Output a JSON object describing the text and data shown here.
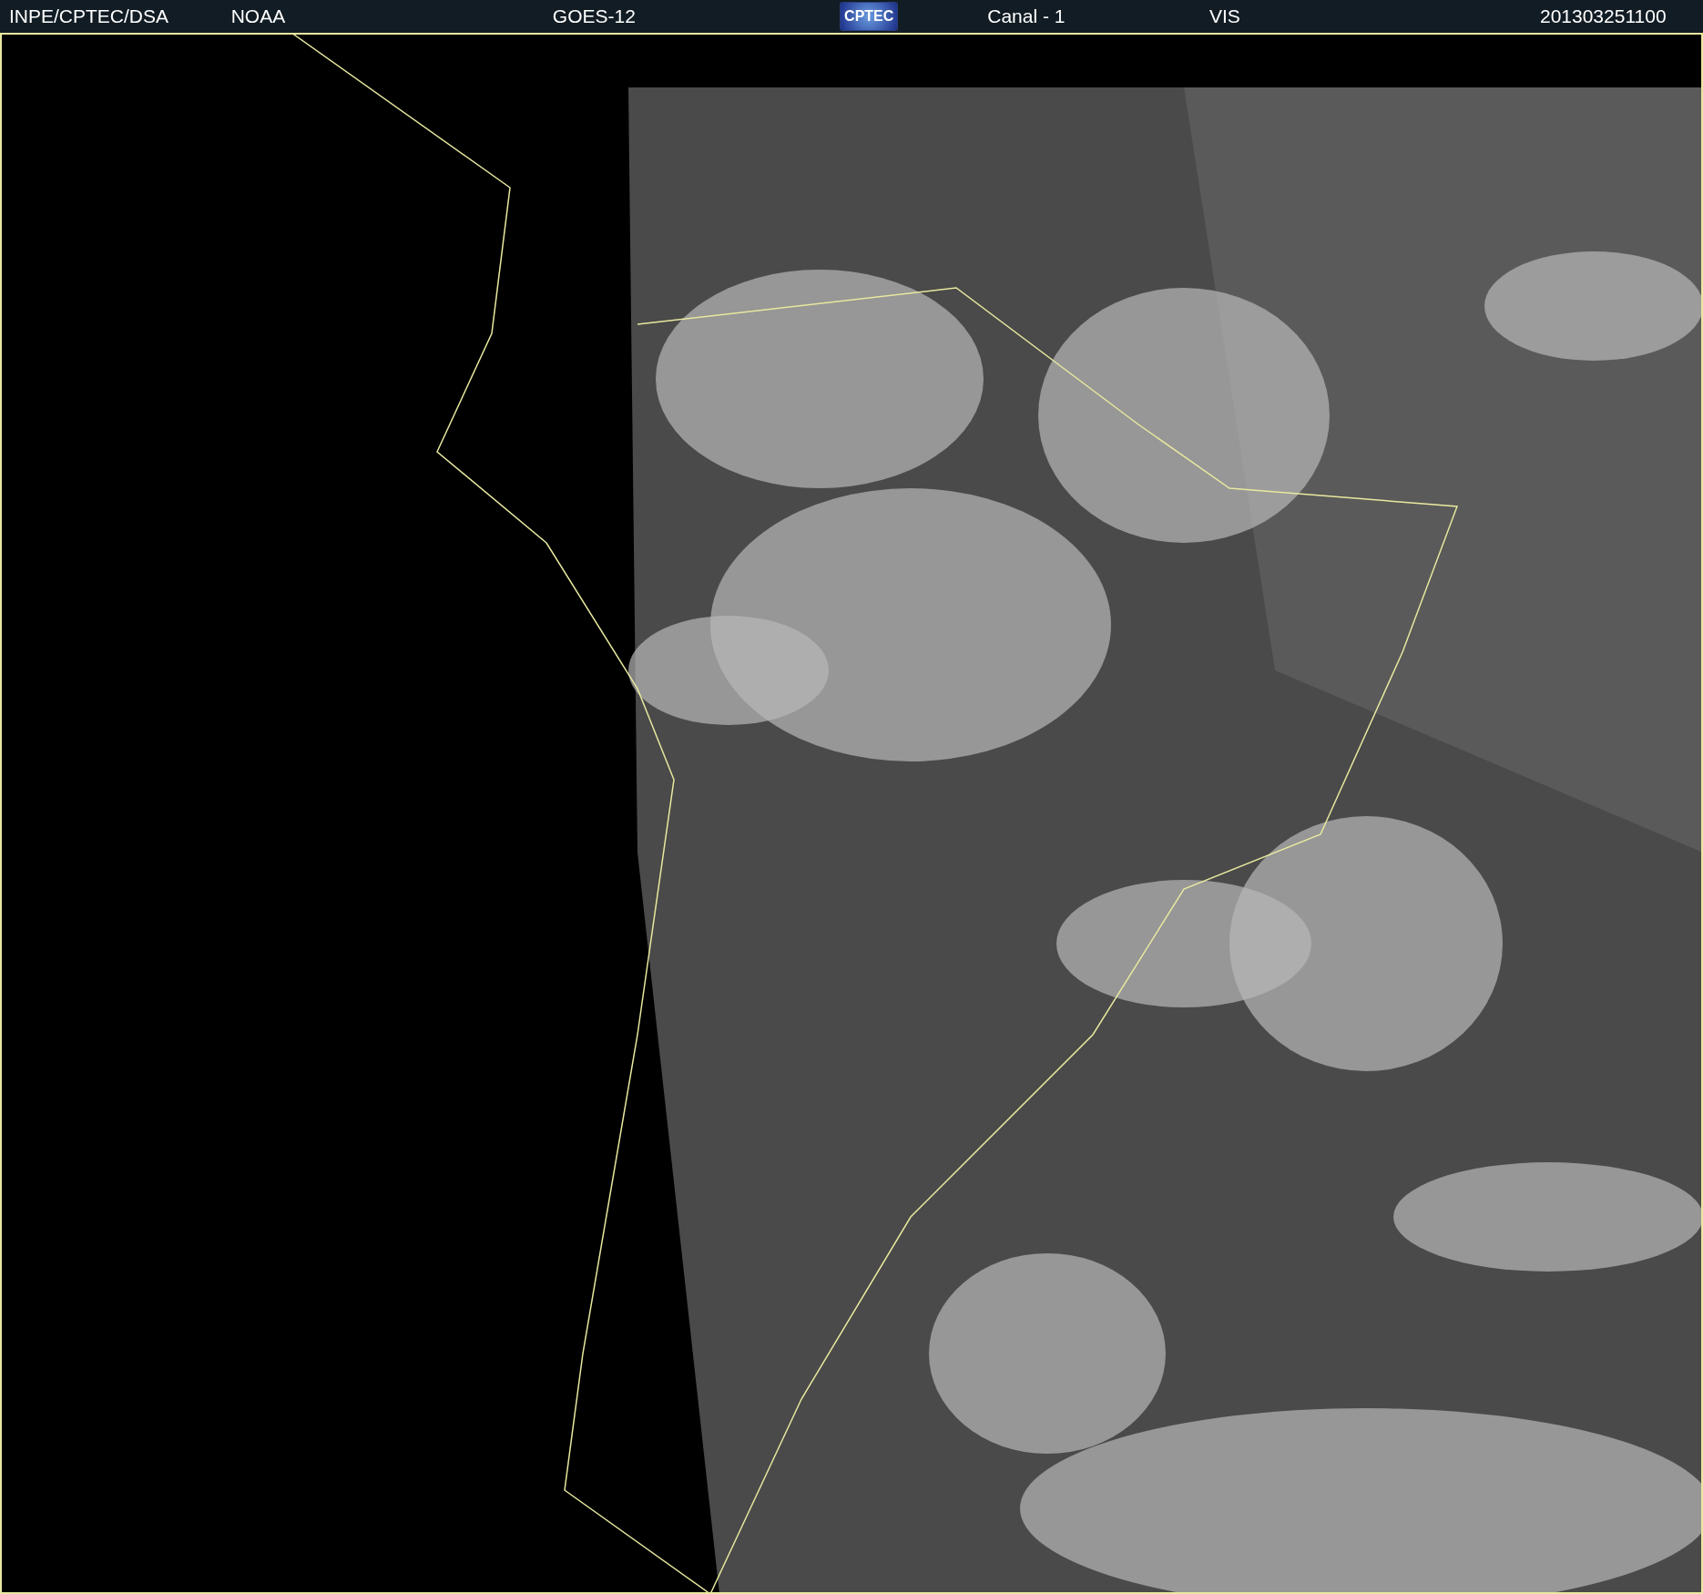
{
  "header": {
    "items": [
      {
        "kind": "text",
        "text": "INPE/CPTEC/DSA"
      },
      {
        "kind": "text",
        "text": "NOAA"
      },
      {
        "kind": "text",
        "text": "GOES-12"
      },
      {
        "kind": "logo",
        "text": "CPTEC"
      },
      {
        "kind": "text",
        "text": "Canal - 1"
      },
      {
        "kind": "text",
        "text": "VIS"
      },
      {
        "kind": "text",
        "text": "201303251100"
      }
    ]
  }
}
